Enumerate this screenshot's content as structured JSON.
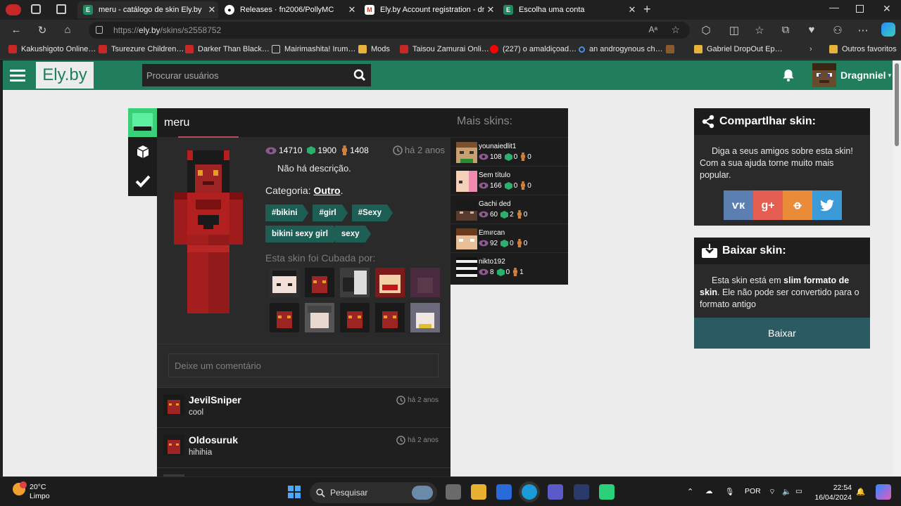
{
  "browser": {
    "tabs": [
      {
        "title": "meru - catálogo de skin Ely.by",
        "favicon": "E"
      },
      {
        "title": "Releases · fn2006/PollyMC",
        "favicon": "github-icon"
      },
      {
        "title": "Ely.by Account registration - dra…",
        "favicon": "M"
      },
      {
        "title": "Escolha uma conta",
        "favicon": "E"
      }
    ],
    "url_prefix": "https://",
    "url_domain": "ely.by",
    "url_path": "/skins/s2558752",
    "bookmarks": [
      "Kakushigoto Online…",
      "Tsurezure Children…",
      "Darker Than Black…",
      "Mairimashita! Irum…",
      "Mods",
      "Taisou Zamurai Onli…",
      "(227) o amaldiçoad…",
      "an androgynous ch…",
      "Gabriel DropOut Ep…"
    ],
    "other_favorites": "Outros favoritos"
  },
  "site": {
    "logo": "Ely.by",
    "search_placeholder": "Procurar usuários",
    "username": "Dragnniel"
  },
  "skin": {
    "name": "meru",
    "views": "14710",
    "downloads": "1900",
    "likes": "1408",
    "ago": "há 2 anos",
    "description": "Não há descrição.",
    "category_label": "Categoria:",
    "category": "Outro",
    "tags": [
      "#bikini",
      "#girl",
      "#Sexy",
      "bikini sexy girl",
      "sexy"
    ],
    "cubed_by": "Esta skin foi Cubada por:",
    "comment_placeholder": "Deixe um comentário"
  },
  "comments": [
    {
      "user": "JevilSniper",
      "text": "cool",
      "time": "há 2 anos"
    },
    {
      "user": "Oldosuruk",
      "text": "hihihia",
      "time": "há 2 anos"
    }
  ],
  "more_skins": {
    "title": "Mais skins:",
    "items": [
      {
        "name": "younaiedlit1",
        "views": "108",
        "downloads": "0",
        "likes": "0"
      },
      {
        "name": "Sem título",
        "views": "166",
        "downloads": "0",
        "likes": "0"
      },
      {
        "name": "Gachi ded",
        "views": "60",
        "downloads": "2",
        "likes": "0"
      },
      {
        "name": "Emırcan",
        "views": "92",
        "downloads": "0",
        "likes": "0"
      },
      {
        "name": "nikto192",
        "views": "8",
        "downloads": "0",
        "likes": "1"
      }
    ]
  },
  "share": {
    "title": "Compartlhar skin:",
    "text": "Diga a seus amigos sobre esta skin! Com a sua ajuda torne muito mais popular."
  },
  "download": {
    "title": "Baixar skin:",
    "text_pre": "Esta skin está em",
    "text_bold": "slim formato de skin",
    "text_post": ". Ele não pode ser convertido para o formato antigo",
    "button": "Baixar"
  },
  "taskbar": {
    "temp": "20°C",
    "weather": "Limpo",
    "search": "Pesquisar",
    "lang": "POR",
    "time": "22:54",
    "date": "16/04/2024"
  },
  "colors": {
    "brand": "#207e5c",
    "tag": "#1e5f55",
    "download_btn": "#2c5a62"
  }
}
